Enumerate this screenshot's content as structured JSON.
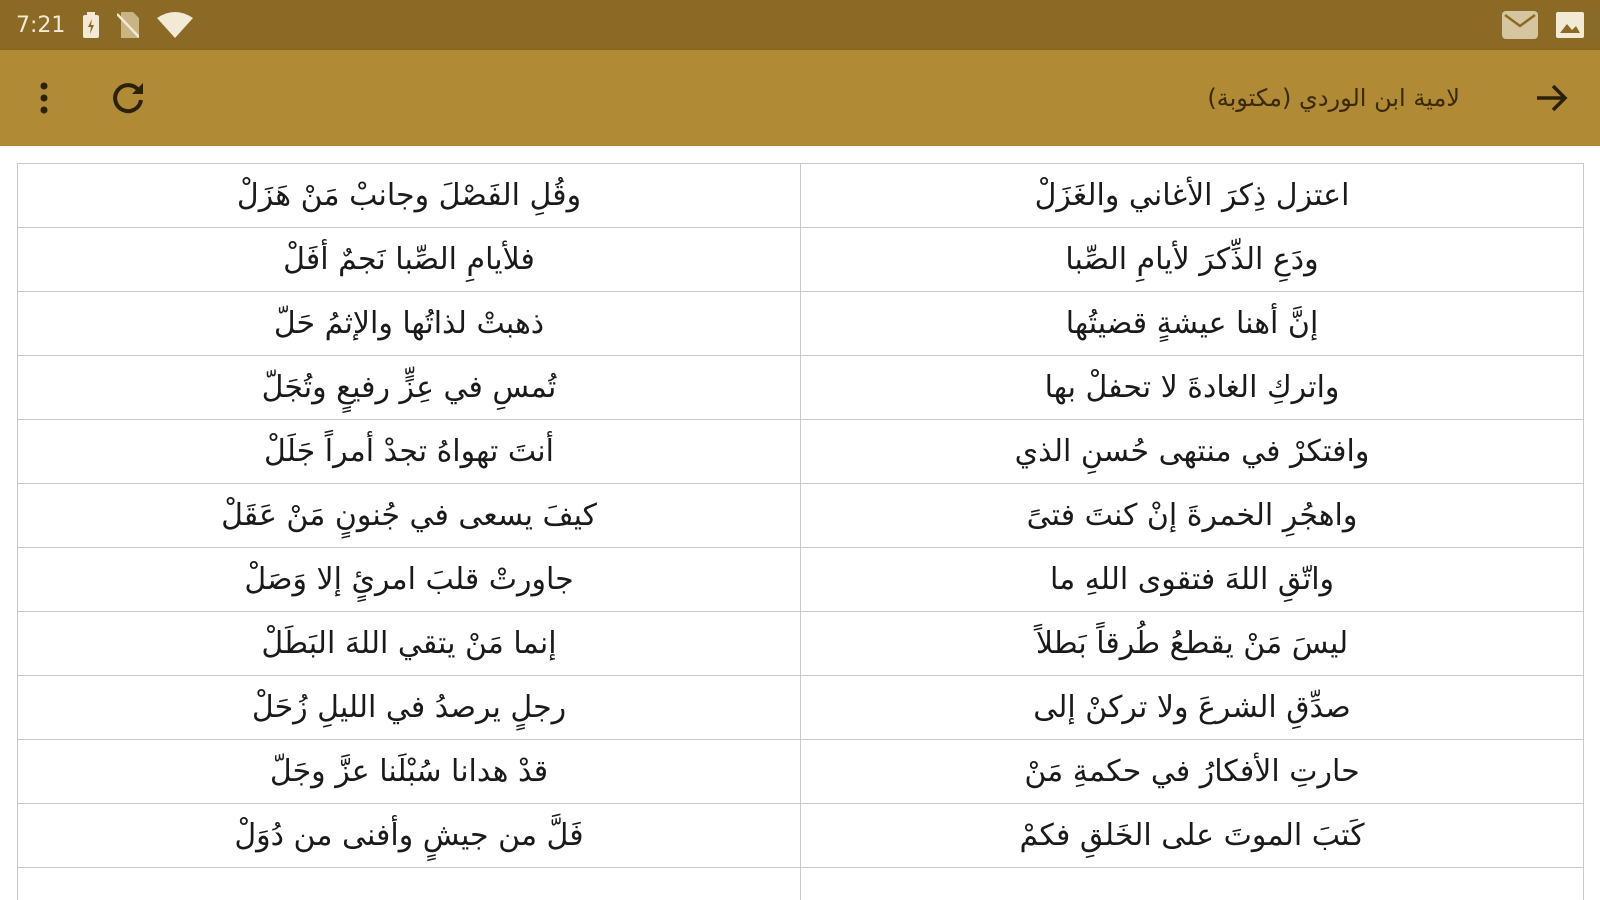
{
  "status_bar": {
    "time": "7:21",
    "icons": [
      "battery-icon",
      "no-sim-icon",
      "wifi-icon",
      "email-icon",
      "image-icon"
    ]
  },
  "app_bar": {
    "title": "لامية ابن الوردي (مكتوبة)",
    "back_icon": "arrow-right-icon",
    "refresh_icon": "refresh-icon",
    "menu_icon": "more-vert-icon"
  },
  "poem": {
    "verses": [
      {
        "first": "اعتزل ذِكرَ الأغاني والغَزَلْ",
        "second": "وقُلِ الفَصْلَ وجانبْ مَنْ هَزَلْ"
      },
      {
        "first": "ودَعِ الذِّكرَ لأيامِ الصِّبا",
        "second": "فلأيامِ الصِّبا نَجمٌ أفَلْ"
      },
      {
        "first": "إنَّ أهنا عيشةٍ قضيتُها",
        "second": "ذهبتْ لذاتُها والإثمُ حَلّ"
      },
      {
        "first": "واتركِ الغادةَ لا تحفلْ بها",
        "second": "تُمسِ في عِزٍّ رفيعٍ وتُجَلّ"
      },
      {
        "first": "وافتكرْ في منتهى حُسنِ الذي",
        "second": "أنتَ تهواهُ تجدْ أمراً جَلَلْ"
      },
      {
        "first": "واهجُرِ الخمرةَ إنْ كنتَ فتىً",
        "second": "كيفَ يسعى في جُنونٍ مَنْ عَقَلْ"
      },
      {
        "first": "واتّقِ اللهَ فتقوى اللهِ ما",
        "second": "جاورتْ قلبَ امرئٍ إلا وَصَلْ"
      },
      {
        "first": "ليسَ مَنْ يقطعُ طُرقاً بَطلاً",
        "second": "إنما مَنْ يتقي اللهَ البَطَلْ"
      },
      {
        "first": "صدِّقِ الشرعَ ولا تركنْ إلى",
        "second": "رجلٍ يرصدُ في الليلِ زُحَلْ"
      },
      {
        "first": "حارتِ الأفكارُ في حكمةِ مَنْ",
        "second": "قدْ هدانا سُبْلَنا عزَّ وجَلّ"
      },
      {
        "first": "كَتبَ الموتَ على الخَلقِ فكمْ",
        "second": "فَلَّ من جيشٍ وأفنى من دُوَلْ"
      }
    ]
  }
}
